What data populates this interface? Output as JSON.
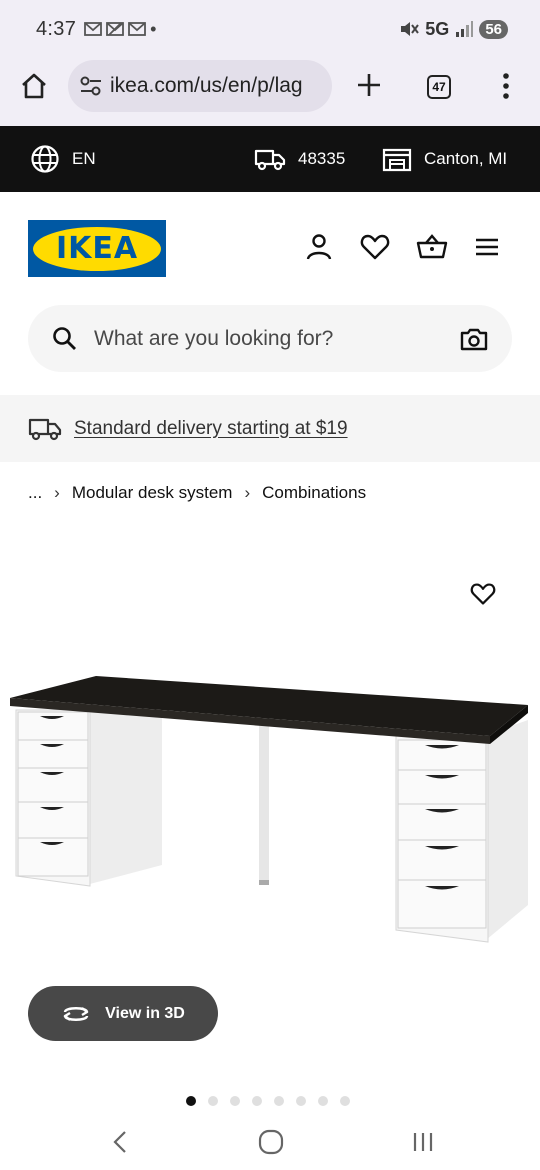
{
  "status": {
    "time": "4:37",
    "network": "5G",
    "battery": "56"
  },
  "browser": {
    "url": "ikea.com/us/en/p/lag",
    "tab_count": "47"
  },
  "top_strip": {
    "language": "EN",
    "zip": "48335",
    "store": "Canton, MI"
  },
  "header": {
    "logo_text": "IKEA"
  },
  "search": {
    "placeholder": "What are you looking for?"
  },
  "delivery": {
    "text": "Standard delivery starting at $19"
  },
  "breadcrumb": {
    "ellipsis": "...",
    "items": [
      "Modular desk system",
      "Combinations"
    ]
  },
  "product": {
    "view3d_label": "View in 3D",
    "gallery_total": 8,
    "gallery_active": 1
  },
  "colors": {
    "ikea_blue": "#0058a3",
    "ikea_yellow": "#ffdb00",
    "desk_top": "#1c1a17",
    "strip_bg": "#111111"
  }
}
